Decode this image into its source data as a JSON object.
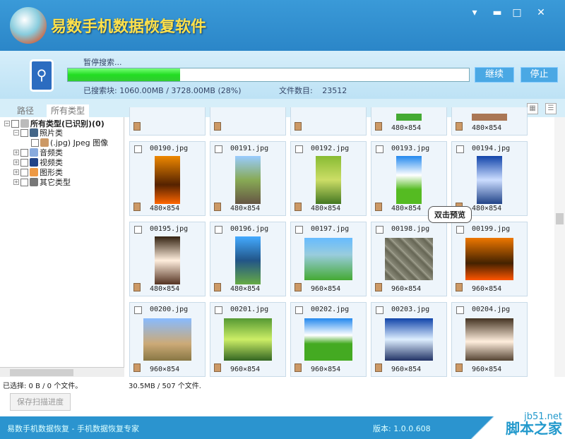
{
  "app": {
    "title": "易数手机数据恢复软件",
    "min": "▾",
    "minimize": "▬",
    "maximize": "□",
    "close": "✕"
  },
  "scan": {
    "status": "暂停搜索...",
    "progress": 28,
    "searched": "已搜索块: 1060.00MB / 3728.00MB (28%)",
    "file_count_label": "文件数目:",
    "file_count": "23512",
    "continue": "继续",
    "stop": "停止"
  },
  "tabs": [
    "路径",
    "所有类型"
  ],
  "tree": [
    {
      "label": "所有类型(已识别)(0)",
      "level": 0,
      "exp": "−",
      "color": "#bbb"
    },
    {
      "label": "照片类",
      "level": 1,
      "exp": "−",
      "color": "#468"
    },
    {
      "label": "(.jpg) Jpeg 图像",
      "level": 2,
      "exp": "",
      "color": "#c96"
    },
    {
      "label": "音频类",
      "level": 1,
      "exp": "+",
      "color": "#8ad"
    },
    {
      "label": "视频类",
      "level": 1,
      "exp": "+",
      "color": "#248"
    },
    {
      "label": "图形类",
      "level": 1,
      "exp": "+",
      "color": "#e94"
    },
    {
      "label": "其它类型",
      "level": 1,
      "exp": "+",
      "color": "#777"
    }
  ],
  "files_top": [
    {
      "dim": ""
    },
    {
      "dim": ""
    },
    {
      "dim": ""
    },
    {
      "dim": "480×854",
      "bg": "#4a3"
    },
    {
      "dim": "480×854",
      "bg": "#a75"
    }
  ],
  "files": [
    {
      "name": "00190.jpg",
      "dim": "480×854",
      "p": true,
      "bg": "linear-gradient(#e80,#520 60%,#f60)"
    },
    {
      "name": "00191.jpg",
      "dim": "480×854",
      "p": true,
      "bg": "linear-gradient(#9cf,#8a5 50%,#654)"
    },
    {
      "name": "00192.jpg",
      "dim": "480×854",
      "p": true,
      "bg": "linear-gradient(#8b3,#cd6 50%,#472)"
    },
    {
      "name": "00193.jpg",
      "dim": "480×854",
      "p": true,
      "bg": "linear-gradient(#28e,#fff 40%,#5b2 70%)"
    },
    {
      "name": "00194.jpg",
      "dim": "480×854",
      "p": true,
      "bg": "linear-gradient(#14a,#cdf 50%,#248)"
    },
    {
      "name": "00195.jpg",
      "dim": "480×854",
      "p": true,
      "bg": "linear-gradient(#321,#fed 50%,#532)"
    },
    {
      "name": "00196.jpg",
      "dim": "480×854",
      "p": true,
      "bg": "linear-gradient(#4af,#258 50%,#6a4)"
    },
    {
      "name": "00197.jpg",
      "dim": "960×854",
      "p": false,
      "bg": "linear-gradient(#6bf,#9cd 40%,#4a3)"
    },
    {
      "name": "00198.jpg",
      "dim": "960×854",
      "p": false,
      "bg": "repeating-linear-gradient(45deg,#887,#665 8px,#aa9 12px)"
    },
    {
      "name": "00199.jpg",
      "dim": "960×854",
      "p": false,
      "bg": "linear-gradient(#e70,#420 60%,#f50)"
    },
    {
      "name": "00200.jpg",
      "dim": "960×854",
      "p": false,
      "bg": "linear-gradient(#8bf,#ca7 60%,#874)"
    },
    {
      "name": "00201.jpg",
      "dim": "960×854",
      "p": false,
      "bg": "linear-gradient(#593,#ce6 50%,#362)"
    },
    {
      "name": "00202.jpg",
      "dim": "960×854",
      "p": false,
      "bg": "linear-gradient(#28e,#fff 40%,#4a2 60%)"
    },
    {
      "name": "00203.jpg",
      "dim": "960×854",
      "p": false,
      "bg": "linear-gradient(#14a,#def 50%,#236)"
    },
    {
      "name": "00204.jpg",
      "dim": "960×854",
      "p": false,
      "bg": "linear-gradient(#432,#fed 55%,#543)"
    }
  ],
  "tooltip": "双击预览",
  "status": {
    "selected": "已选择: 0 B / 0 个文件。",
    "total": "30.5MB / 507 个文件."
  },
  "save_button": "保存扫描进度",
  "footer": {
    "left": "易数手机数据恢复 - 手机数据恢复专家",
    "version": "版本: 1.0.0.608"
  },
  "watermark": {
    "site": "jb51.net",
    "name": "脚本之家"
  }
}
